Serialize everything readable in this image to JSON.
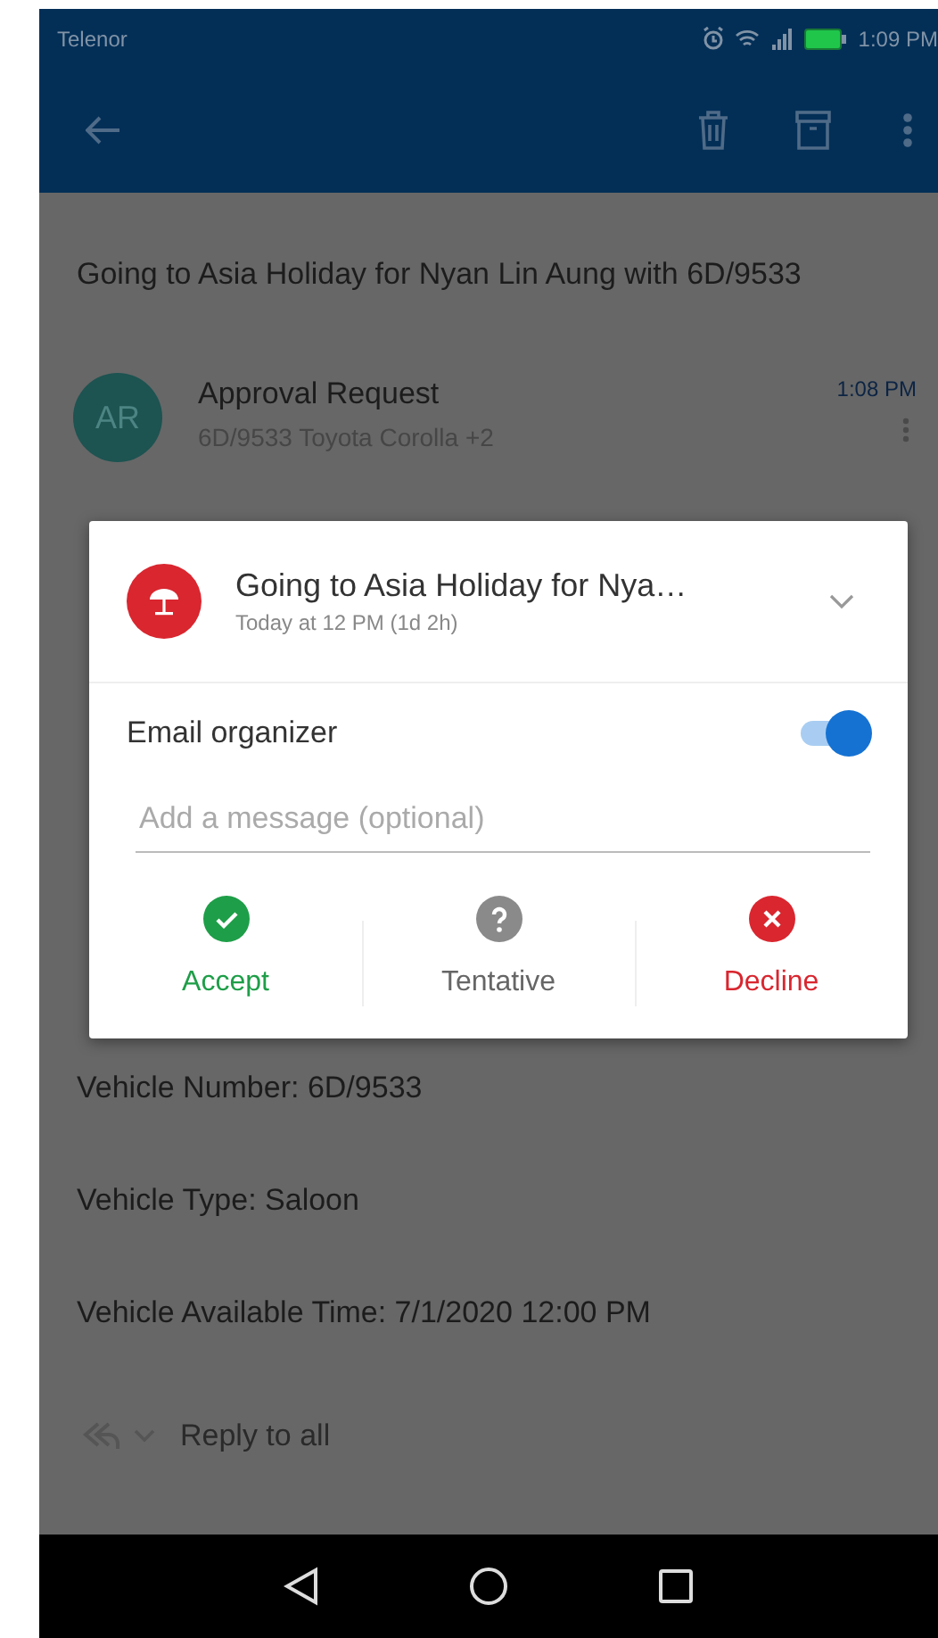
{
  "status_bar": {
    "carrier": "Telenor",
    "time": "1:09 PM"
  },
  "email": {
    "subject": "Going to Asia Holiday for Nyan Lin Aung with 6D/9533",
    "sender": {
      "initials": "AR",
      "name": "Approval Request",
      "recipients": "6D/9533 Toyota Corolla +2",
      "time": "1:08 PM"
    },
    "body": [
      "Vehicle Number: 6D/9533",
      "Vehicle Type: Saloon",
      "Vehicle Available Time: 7/1/2020 12:00 PM"
    ],
    "reply": {
      "label": "Reply to all"
    }
  },
  "dialog": {
    "title": "Going to Asia Holiday for Nya…",
    "when": "Today at 12 PM (1d 2h)",
    "email_organizer": {
      "label": "Email organizer",
      "on": true
    },
    "message": {
      "placeholder": "Add a message (optional)"
    },
    "responses": [
      {
        "kind": "accept",
        "label": "Accept"
      },
      {
        "kind": "tentative",
        "label": "Tentative"
      },
      {
        "kind": "decline",
        "label": "Decline"
      }
    ]
  }
}
